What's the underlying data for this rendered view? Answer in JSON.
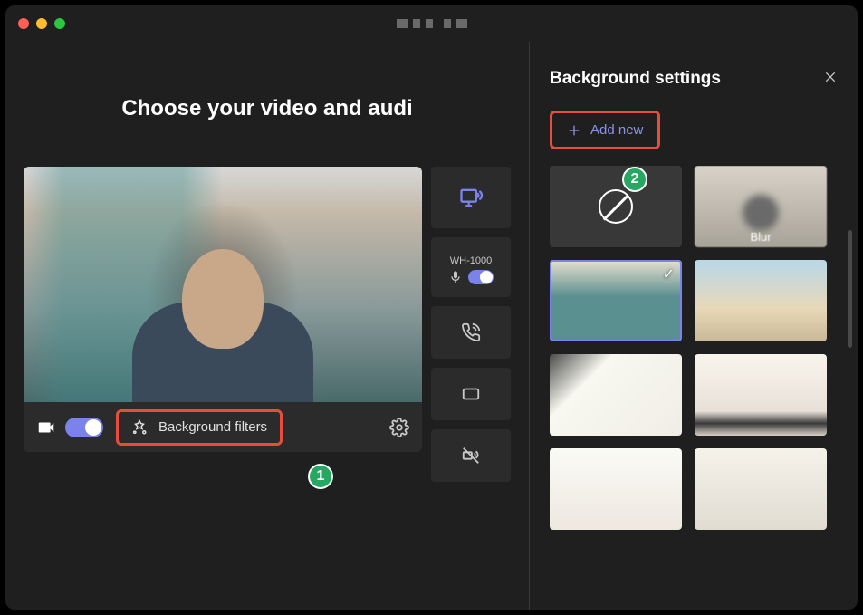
{
  "heading": "Choose your video and audi",
  "video_toolbar": {
    "background_filters_label": "Background filters"
  },
  "audio_device": "WH-1000",
  "panel": {
    "title": "Background settings",
    "add_new_label": "Add new",
    "blur_label": "Blur"
  },
  "annotations": {
    "badge1": "1",
    "badge2": "2"
  }
}
